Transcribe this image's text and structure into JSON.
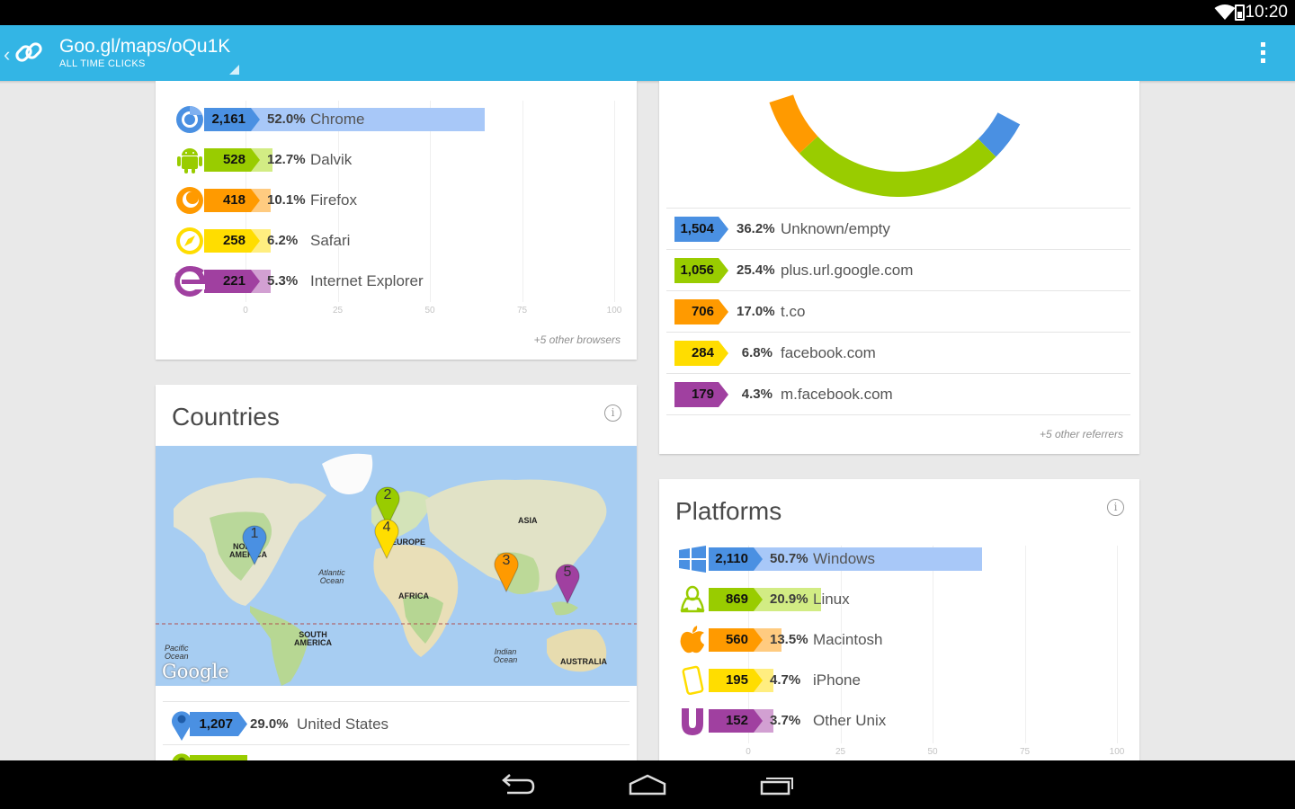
{
  "status": {
    "time": "10:20"
  },
  "actionbar": {
    "title": "Goo.gl/maps/oQu1K",
    "subtitle": "ALL TIME CLICKS"
  },
  "colors": {
    "blue": "#4a90e2",
    "green": "#99cc00",
    "orange": "#ff9a00",
    "yellow": "#ffdd00",
    "purple": "#a040a0",
    "actionbar": "#33b5e5"
  },
  "browsers": {
    "rows": [
      {
        "icon": "chrome-icon",
        "count": "2,161",
        "pct": "52.0%",
        "name": "Chrome",
        "value": 52.0,
        "color": "#4a90e2",
        "fill": "#a8c8f8"
      },
      {
        "icon": "android-icon",
        "count": "528",
        "pct": "12.7%",
        "name": "Dalvik",
        "value": 12.7,
        "color": "#99cc00",
        "fill": "#d2ec84"
      },
      {
        "icon": "firefox-icon",
        "count": "418",
        "pct": "10.1%",
        "name": "Firefox",
        "value": 10.1,
        "color": "#ff9a00",
        "fill": "#ffcb80"
      },
      {
        "icon": "safari-icon",
        "count": "258",
        "pct": "6.2%",
        "name": "Safari",
        "value": 6.2,
        "color": "#ffdd00",
        "fill": "#ffee80"
      },
      {
        "icon": "ie-icon",
        "count": "221",
        "pct": "5.3%",
        "name": "Internet Explorer",
        "value": 5.3,
        "color": "#a040a0",
        "fill": "#d2a0d2"
      }
    ],
    "ticks": [
      "0",
      "25",
      "50",
      "75",
      "100"
    ],
    "more": "+5 other browsers"
  },
  "countries": {
    "title": "Countries",
    "map": {
      "regions": {
        "north_america": "NORTH AMERICA",
        "europe": "EUROPE",
        "asia": "ASIA",
        "africa": "AFRICA",
        "south_america": "SOUTH AMERICA",
        "australia": "AUSTRALIA"
      },
      "oceans": {
        "atlantic": "Atlantic Ocean",
        "pacific": "Pacific Ocean",
        "indian": "Indian Ocean"
      },
      "logo": "Google",
      "markers": [
        "1",
        "2",
        "3",
        "4",
        "5"
      ]
    },
    "rows": [
      {
        "count": "1,207",
        "pct": "29.0%",
        "name": "United States",
        "color": "#4a90e2"
      }
    ]
  },
  "referrers": {
    "donut": [
      {
        "name": "Unknown/empty",
        "value": 36.2,
        "color": "#4a90e2"
      },
      {
        "name": "plus.url.google.com",
        "value": 25.4,
        "color": "#99cc00"
      },
      {
        "name": "t.co",
        "value": 17.0,
        "color": "#ff9a00"
      }
    ],
    "rows": [
      {
        "count": "1,504",
        "pct": "36.2%",
        "name": "Unknown/empty",
        "color": "#4a90e2"
      },
      {
        "count": "1,056",
        "pct": "25.4%",
        "name": "plus.url.google.com",
        "color": "#99cc00"
      },
      {
        "count": "706",
        "pct": "17.0%",
        "name": "t.co",
        "color": "#ff9a00"
      },
      {
        "count": "284",
        "pct": "6.8%",
        "name": "facebook.com",
        "color": "#ffdd00"
      },
      {
        "count": "179",
        "pct": "4.3%",
        "name": "m.facebook.com",
        "color": "#a040a0"
      }
    ],
    "more": "+5 other referrers"
  },
  "platforms": {
    "title": "Platforms",
    "rows": [
      {
        "icon": "windows-icon",
        "count": "2,110",
        "pct": "50.7%",
        "name": "Windows",
        "value": 50.7,
        "color": "#4a90e2",
        "fill": "#a8c8f8"
      },
      {
        "icon": "linux-icon",
        "count": "869",
        "pct": "20.9%",
        "name": "Linux",
        "value": 20.9,
        "color": "#99cc00",
        "fill": "#d2ec84"
      },
      {
        "icon": "apple-icon",
        "count": "560",
        "pct": "13.5%",
        "name": "Macintosh",
        "value": 13.5,
        "color": "#ff9a00",
        "fill": "#ffcb80"
      },
      {
        "icon": "iphone-icon",
        "count": "195",
        "pct": "4.7%",
        "name": "iPhone",
        "value": 4.7,
        "color": "#ffdd00",
        "fill": "#ffee80"
      },
      {
        "icon": "unix-icon",
        "count": "152",
        "pct": "3.7%",
        "name": "Other Unix",
        "value": 3.7,
        "color": "#a040a0",
        "fill": "#d2a0d2"
      }
    ],
    "ticks": [
      "0",
      "25",
      "50",
      "75",
      "100"
    ]
  }
}
